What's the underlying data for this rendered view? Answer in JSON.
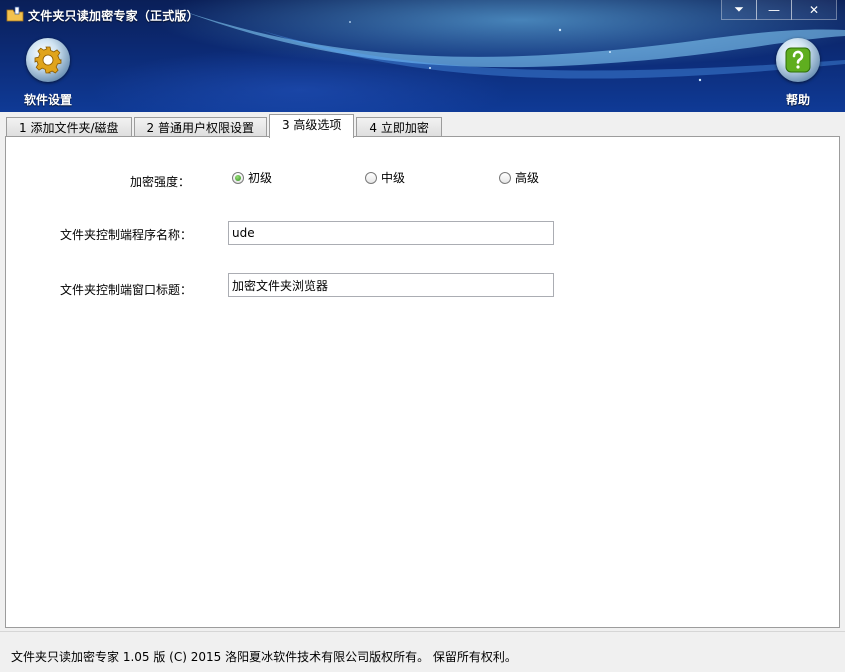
{
  "window": {
    "title": "文件夹只读加密专家（正式版）",
    "controls": {
      "menu_glyph": "⏷",
      "minimize_glyph": "—",
      "close_glyph": "✕"
    }
  },
  "toolbar": {
    "settings_label": "软件设置",
    "settings_icon": "gear-icon",
    "help_label": "帮助",
    "help_icon": "question-icon"
  },
  "tabs": [
    {
      "label": "1 添加文件夹/磁盘",
      "active": false
    },
    {
      "label": "2 普通用户权限设置",
      "active": false
    },
    {
      "label": "3 高级选项",
      "active": true
    },
    {
      "label": "4 立即加密",
      "active": false
    }
  ],
  "advanced": {
    "strength_label": "加密强度：",
    "strength_options": [
      {
        "label": "初级",
        "selected": true
      },
      {
        "label": "中级",
        "selected": false
      },
      {
        "label": "高级",
        "selected": false
      }
    ],
    "program_name_label": "文件夹控制端程序名称：",
    "program_name_value": "ude",
    "window_title_label": "文件夹控制端窗口标题：",
    "window_title_value": "加密文件夹浏览器"
  },
  "status": {
    "text": "文件夹只读加密专家 1.05 版  (C)  2015 洛阳夏冰软件技术有限公司版权所有。 保留所有权利。"
  },
  "colors": {
    "header_dark": "#0a1f58",
    "header_light": "#0f3a96",
    "help_green": "#5fae1f",
    "radio_green": "#2f8f1f"
  }
}
